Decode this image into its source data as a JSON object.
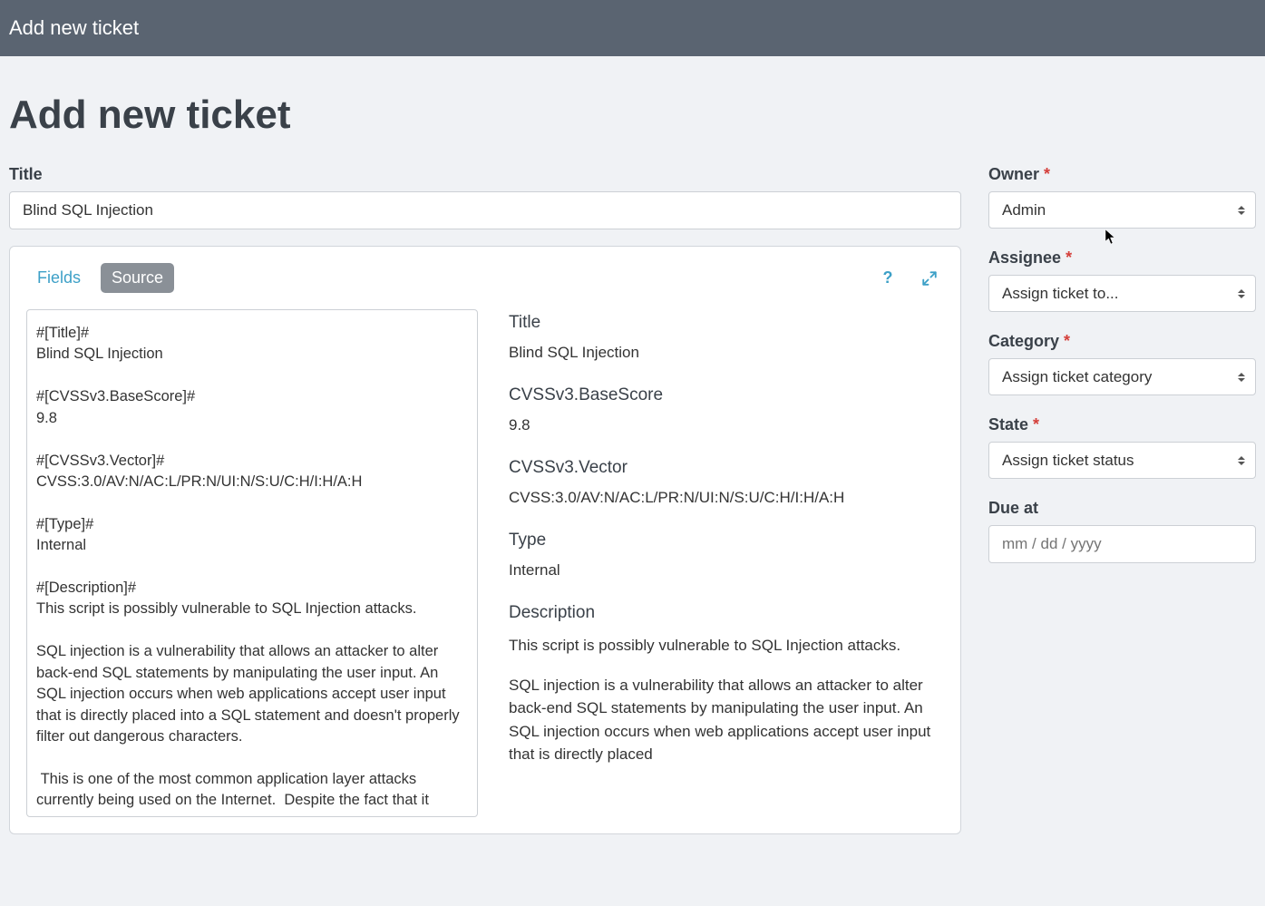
{
  "topbar": {
    "title": "Add new ticket"
  },
  "page": {
    "heading": "Add new ticket"
  },
  "title_field": {
    "label": "Title",
    "value": "Blind SQL Injection"
  },
  "editor": {
    "tabs": {
      "fields": "Fields",
      "source": "Source"
    },
    "source_text": "#[Title]#\nBlind SQL Injection\n\n#[CVSSv3.BaseScore]#\n9.8\n\n#[CVSSv3.Vector]#\nCVSS:3.0/AV:N/AC:L/PR:N/UI:N/S:U/C:H/I:H/A:H\n\n#[Type]#\nInternal\n\n#[Description]#\nThis script is possibly vulnerable to SQL Injection attacks.\n\nSQL injection is a vulnerability that allows an attacker to alter back-end SQL statements by manipulating the user input. An SQL injection occurs when web applications accept user input that is directly placed into a SQL statement and doesn't properly filter out dangerous characters.\n\n This is one of the most common application layer attacks currently being used on the Internet.  Despite the fact that it"
  },
  "preview": {
    "title_label": "Title",
    "title_value": "Blind SQL Injection",
    "basescore_label": "CVSSv3.BaseScore",
    "basescore_value": "9.8",
    "vector_label": "CVSSv3.Vector",
    "vector_value": "CVSS:3.0/AV:N/AC:L/PR:N/UI:N/S:U/C:H/I:H/A:H",
    "type_label": "Type",
    "type_value": "Internal",
    "description_label": "Description",
    "description_p1": "This script is possibly vulnerable to SQL Injection attacks.",
    "description_p2": "SQL injection is a vulnerability that allows an attacker to alter back-end SQL statements by manipulating the user input. An SQL injection occurs when web applications accept user input that is directly placed"
  },
  "sidebar": {
    "owner": {
      "label": "Owner",
      "value": "Admin"
    },
    "assignee": {
      "label": "Assignee",
      "value": "Assign ticket to..."
    },
    "category": {
      "label": "Category",
      "value": "Assign ticket category"
    },
    "state": {
      "label": "State",
      "value": "Assign ticket status"
    },
    "due": {
      "label": "Due at",
      "placeholder": "mm / dd / yyyy"
    }
  }
}
